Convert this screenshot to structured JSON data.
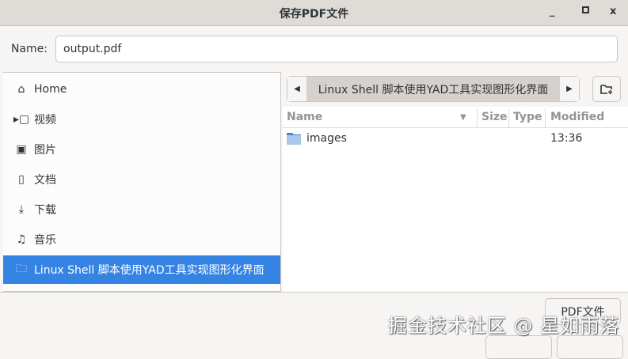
{
  "window": {
    "title": "保存PDF文件",
    "minimize": "_",
    "maximize": "▫",
    "close": "x"
  },
  "name_row": {
    "label": "Name:",
    "value": "output.pdf"
  },
  "sidebar": {
    "items": [
      {
        "label": "Home",
        "icon": "home-icon"
      },
      {
        "label": "视频",
        "icon": "video-icon"
      },
      {
        "label": "图片",
        "icon": "image-icon"
      },
      {
        "label": "文档",
        "icon": "document-icon"
      },
      {
        "label": "下载",
        "icon": "download-icon"
      },
      {
        "label": "音乐",
        "icon": "music-icon"
      },
      {
        "label": "Linux Shell 脚本使用YAD工具实现图形化界面",
        "icon": "folder-icon",
        "selected": true
      }
    ]
  },
  "pathbar": {
    "current": "Linux Shell 脚本使用YAD工具实现图形化界面"
  },
  "filelist": {
    "columns": [
      "Name",
      "Size",
      "Type",
      "Modified"
    ],
    "rows": [
      {
        "name": "images",
        "size": "",
        "type": "",
        "modified": "13:36"
      }
    ]
  },
  "filter_button": "PDF文件",
  "watermark": "掘金技术社区 @ 星如雨落",
  "colors": {
    "accent": "#3584e4"
  }
}
